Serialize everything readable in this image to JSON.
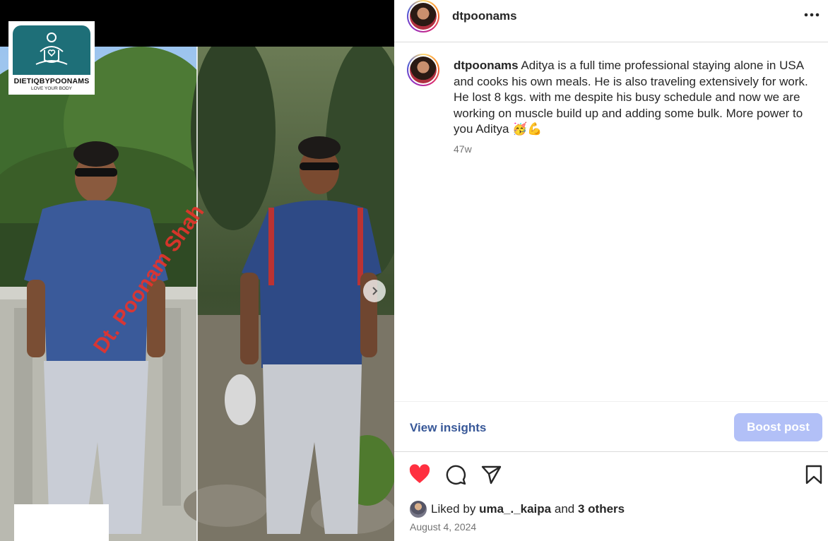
{
  "media": {
    "logo": {
      "brand": "DIETIQBYPOONAMS",
      "tagline": "LOVE YOUR BODY"
    },
    "watermark": "Dt. Poonam Shah"
  },
  "header": {
    "username": "dtpoonams"
  },
  "caption": {
    "username": "dtpoonams",
    "text": "Aditya is a full time professional staying alone in USA and cooks his own meals. He is also traveling extensively for work. He lost 8 kgs. with me despite his busy schedule and now we are working on muscle build up and adding some bulk. More power to you Aditya 🥳💪",
    "time": "47w"
  },
  "insights": {
    "view_label": "View insights",
    "boost_label": "Boost post"
  },
  "likes": {
    "prefix": "Liked by",
    "user": "uma_._kaipa",
    "and": "and",
    "others": "3 others"
  },
  "date": "August 4, 2024",
  "colors": {
    "like_red": "#ff3040",
    "link_blue": "#385898",
    "boost_disabled": "#b2c0f7"
  }
}
